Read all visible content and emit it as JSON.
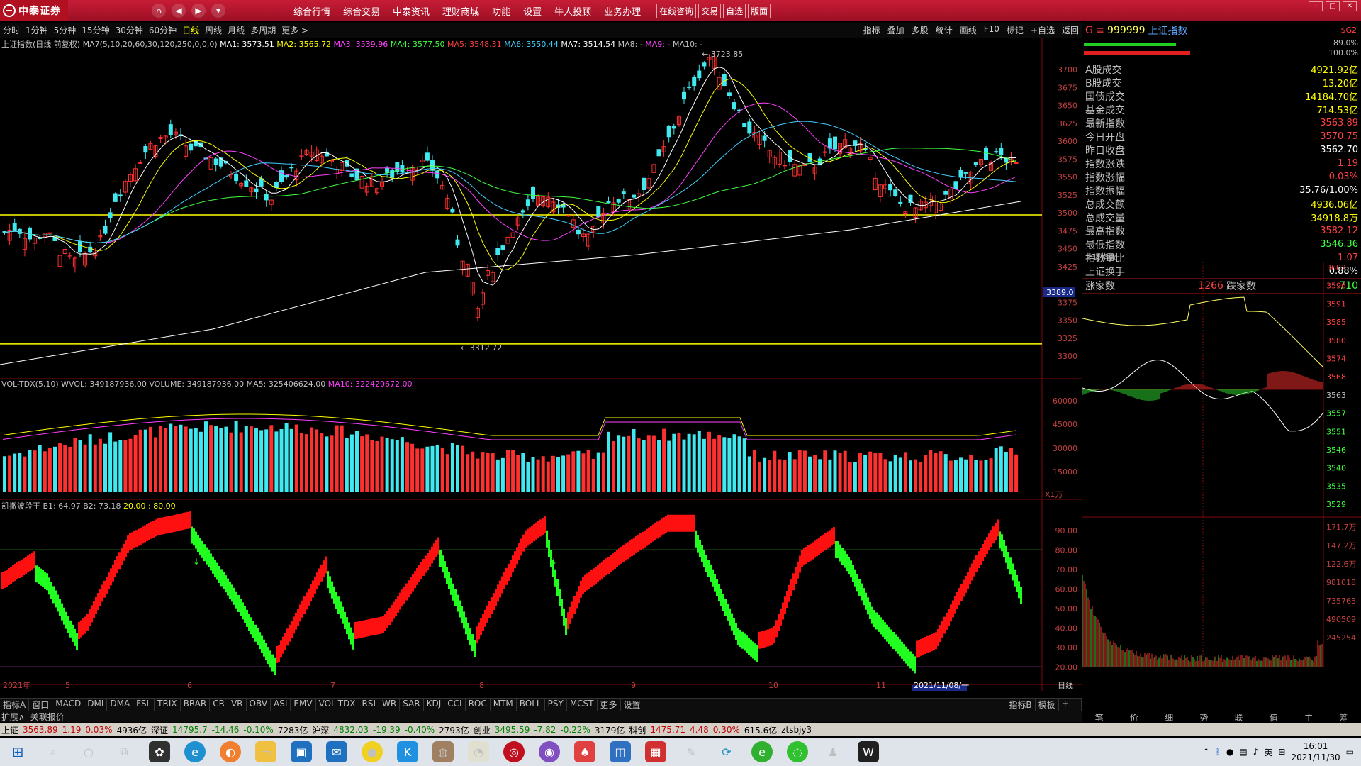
{
  "app": {
    "title": "中泰证券",
    "menu": [
      "综合行情",
      "综合交易",
      "中泰资讯",
      "理财商城",
      "功能",
      "设置",
      "牛人投顾",
      "业务办理"
    ],
    "quick": [
      "在线咨询",
      "交易",
      "自选",
      "版面"
    ]
  },
  "toolbar": {
    "periods": [
      "分时",
      "1分钟",
      "5分钟",
      "15分钟",
      "30分钟",
      "60分钟",
      "日线",
      "周线",
      "月线",
      "多周期",
      "更多 >"
    ],
    "active_period": "日线",
    "tools": [
      "指标",
      "叠加",
      "多股",
      "统计",
      "画线",
      "F10",
      "标记",
      "+自选",
      "返回"
    ]
  },
  "kline": {
    "title": "上证指数(日线 前复权)",
    "ma_header": "MA7(5,10,20,60,30,120,250,0,0,0)",
    "ma": [
      {
        "label": "MA1: 3573.51",
        "color": "#ffffff"
      },
      {
        "label": "MA2: 3565.72",
        "color": "#ffff00"
      },
      {
        "label": "MA3: 3539.96",
        "color": "#ff40ff"
      },
      {
        "label": "MA4: 3577.50",
        "color": "#40ff40"
      },
      {
        "label": "MA5: 3548.31",
        "color": "#ff4040"
      },
      {
        "label": "MA6: 3550.44",
        "color": "#40d0ff"
      },
      {
        "label": "MA7: 3514.54",
        "color": "#ffffff"
      },
      {
        "label": "MA8: -",
        "color": "#c0c0c0"
      },
      {
        "label": "MA9: -",
        "color": "#ff40ff"
      },
      {
        "label": "MA10: -",
        "color": "#c0c0c0"
      }
    ],
    "high_label": "3723.85",
    "low_label": "3312.72",
    "price_marker": "3389.0",
    "y_ticks": [
      "3700",
      "3675",
      "3650",
      "3625",
      "3600",
      "3575",
      "3550",
      "3525",
      "3500",
      "3475",
      "3450",
      "3425",
      "3375",
      "3350",
      "3325",
      "3300"
    ]
  },
  "volume": {
    "legend": "VOL-TDX(5,10)  WVOL: 349187936.00  VOLUME: 349187936.00  MA5: 325406624.00",
    "legend_ma10": "MA10: 322420672.00",
    "y_ticks": [
      "60000",
      "45000",
      "30000",
      "15000"
    ],
    "unit": "X1万"
  },
  "oscillator": {
    "name": "凯撒波段王",
    "b1": "B1: 64.97",
    "b2": "B2: 73.18",
    "levels": "20.00 : 80.00",
    "y_ticks": [
      "90.00",
      "80.00",
      "70.00",
      "60.00",
      "50.00",
      "40.00",
      "30.00",
      "20.00"
    ]
  },
  "x_axis": {
    "labels": [
      "2021年",
      "5",
      "6",
      "7",
      "8",
      "9",
      "10",
      "11"
    ],
    "current": "2021/11/08/一",
    "period": "日线"
  },
  "indicator_tabs": [
    "指标A",
    "窗口",
    "MACD",
    "DMI",
    "DMA",
    "FSL",
    "TRIX",
    "BRAR",
    "CR",
    "VR",
    "OBV",
    "ASI",
    "EMV",
    "VOL-TDX",
    "RSI",
    "WR",
    "SAR",
    "KDJ",
    "CCI",
    "ROC",
    "MTM",
    "BOLL",
    "PSY",
    "MCST",
    "更多",
    "设置"
  ],
  "indicator_right": [
    "指标B",
    "模板",
    "+",
    "-"
  ],
  "subtabs": [
    "扩展∧",
    "关联报价"
  ],
  "right_panel": {
    "code_prefix": "G ≡",
    "code": "999999",
    "name": "上证指数",
    "tag": "$G2",
    "bar_values": [
      "89.0%",
      "100.0%"
    ],
    "stats": [
      {
        "k": "A股成交",
        "v": "4921.92亿",
        "c": "yellow"
      },
      {
        "k": "B股成交",
        "v": "13.20亿",
        "c": "yellow"
      },
      {
        "k": "国债成交",
        "v": "14184.70亿",
        "c": "yellow"
      },
      {
        "k": "基金成交",
        "v": "714.53亿",
        "c": "yellow"
      },
      {
        "k": "最新指数",
        "v": "3563.89",
        "c": "red"
      },
      {
        "k": "今日开盘",
        "v": "3570.75",
        "c": "red"
      },
      {
        "k": "昨日收盘",
        "v": "3562.70",
        "c": "white"
      },
      {
        "k": "指数涨跌",
        "v": "1.19",
        "c": "red"
      },
      {
        "k": "指数涨幅",
        "v": "0.03%",
        "c": "red"
      },
      {
        "k": "指数振幅",
        "v": "35.76/1.00%",
        "c": "white"
      },
      {
        "k": "总成交额",
        "v": "4936.06亿",
        "c": "yellow"
      },
      {
        "k": "总成交量",
        "v": "34918.8万",
        "c": "yellow"
      },
      {
        "k": "最高指数",
        "v": "3582.12",
        "c": "red"
      },
      {
        "k": "最低指数",
        "v": "3546.36",
        "c": "green"
      },
      {
        "k": "指数量比",
        "v": "1.07",
        "c": "red"
      },
      {
        "k": "上证换手",
        "v": "0.88%",
        "c": "white"
      }
    ],
    "adv_label": "涨家数",
    "adv_value": "1266",
    "dec_label": "跌家数",
    "dec_value": "710",
    "mini_title": "上证指数",
    "mini_y_ticks": [
      "3602",
      "3596",
      "3591",
      "3585",
      "3580",
      "3574",
      "3568",
      "3563",
      "3557",
      "3551",
      "3546",
      "3540",
      "3535",
      "3529"
    ],
    "mini_vol_ticks": [
      "171.7万",
      "147.2万",
      "122.6万",
      "981018",
      "735763",
      "490509",
      "245254"
    ],
    "tabs": [
      "笔",
      "价",
      "细",
      "势",
      "联",
      "值",
      "主",
      "筹"
    ]
  },
  "statusbar": {
    "items": [
      {
        "t": "上证",
        "c": ""
      },
      {
        "t": "3563.89",
        "c": "sr"
      },
      {
        "t": "1.19",
        "c": "sr"
      },
      {
        "t": "0.03%",
        "c": "sr"
      },
      {
        "t": "4936亿",
        "c": ""
      },
      {
        "t": "深证",
        "c": ""
      },
      {
        "t": "14795.7",
        "c": "sg"
      },
      {
        "t": "-14.46",
        "c": "sg"
      },
      {
        "t": "-0.10%",
        "c": "sg"
      },
      {
        "t": "7283亿",
        "c": ""
      },
      {
        "t": "沪深",
        "c": ""
      },
      {
        "t": "4832.03",
        "c": "sg"
      },
      {
        "t": "-19.39",
        "c": "sg"
      },
      {
        "t": "-0.40%",
        "c": "sg"
      },
      {
        "t": "2793亿",
        "c": ""
      },
      {
        "t": "创业",
        "c": ""
      },
      {
        "t": "3495.59",
        "c": "sg"
      },
      {
        "t": "-7.82",
        "c": "sg"
      },
      {
        "t": "-0.22%",
        "c": "sg"
      },
      {
        "t": "3179亿",
        "c": ""
      },
      {
        "t": "科创",
        "c": ""
      },
      {
        "t": "1475.71",
        "c": "sr"
      },
      {
        "t": "4.48",
        "c": "sr"
      },
      {
        "t": "0.30%",
        "c": "sr"
      },
      {
        "t": "615.6亿",
        "c": ""
      },
      {
        "t": "ztsbjy3",
        "c": ""
      }
    ]
  },
  "taskbar": {
    "time": "16:01",
    "date": "2021/11/30",
    "ime": "英"
  }
}
